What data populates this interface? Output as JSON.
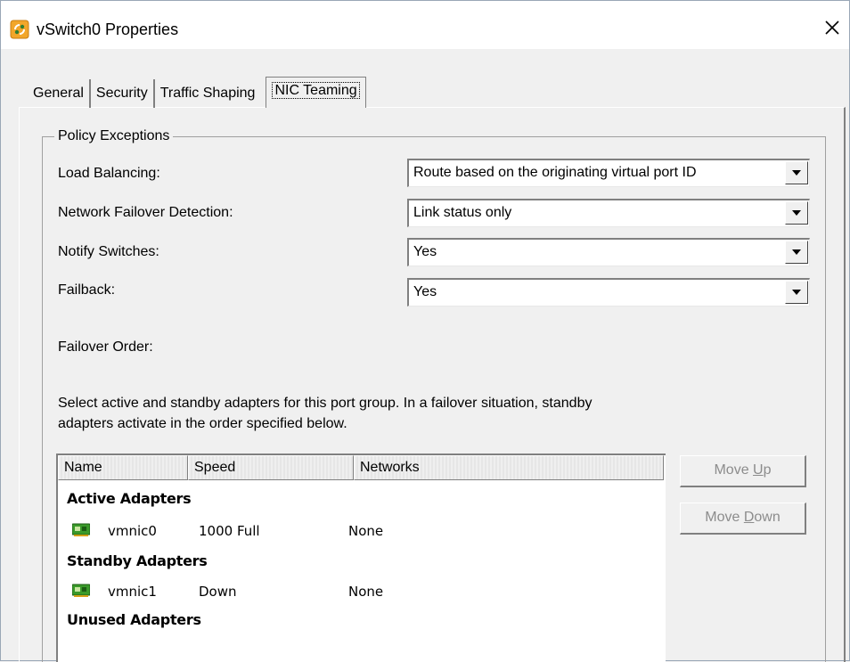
{
  "window": {
    "title": "vSwitch0 Properties",
    "close_glyph": "✕"
  },
  "tabs": [
    {
      "label": "General"
    },
    {
      "label": "Security"
    },
    {
      "label": "Traffic Shaping"
    },
    {
      "label": "NIC Teaming",
      "active": true
    }
  ],
  "policy": {
    "legend": "Policy Exceptions",
    "load_balancing": {
      "label": "Load Balancing:",
      "value": "Route based on the originating virtual port ID"
    },
    "failover_detection": {
      "label": "Network Failover Detection:",
      "value": "Link status only"
    },
    "notify_switches": {
      "label": "Notify Switches:",
      "value": "Yes"
    },
    "failback": {
      "label": "Failback:",
      "value": "Yes"
    },
    "failover_order_label": "Failover Order:",
    "description_line1": "Select active and standby adapters for this port group.  In a failover situation, standby",
    "description_line2": "adapters activate  in the order specified below."
  },
  "adapter_list": {
    "columns": [
      "Name",
      "Speed",
      "Networks"
    ],
    "groups": {
      "active": "Active Adapters",
      "standby": "Standby Adapters",
      "unused": "Unused Adapters"
    },
    "rows": [
      {
        "name": "vmnic0",
        "speed": "1000 Full",
        "networks": "None",
        "icon": "network-adapter-icon"
      },
      {
        "name": "vmnic1",
        "speed": "Down",
        "networks": "None",
        "icon": "network-adapter-icon"
      }
    ]
  },
  "buttons": {
    "move_up_pre": "Move ",
    "move_up_key": "U",
    "move_up_post": "p",
    "move_down_pre": "Move ",
    "move_down_key": "D",
    "move_down_post": "own"
  },
  "colors": {
    "window_bg": "#f0f0f0",
    "disabled_text": "#8c8c8c",
    "nic_icon_green": "#3a9a2a"
  }
}
